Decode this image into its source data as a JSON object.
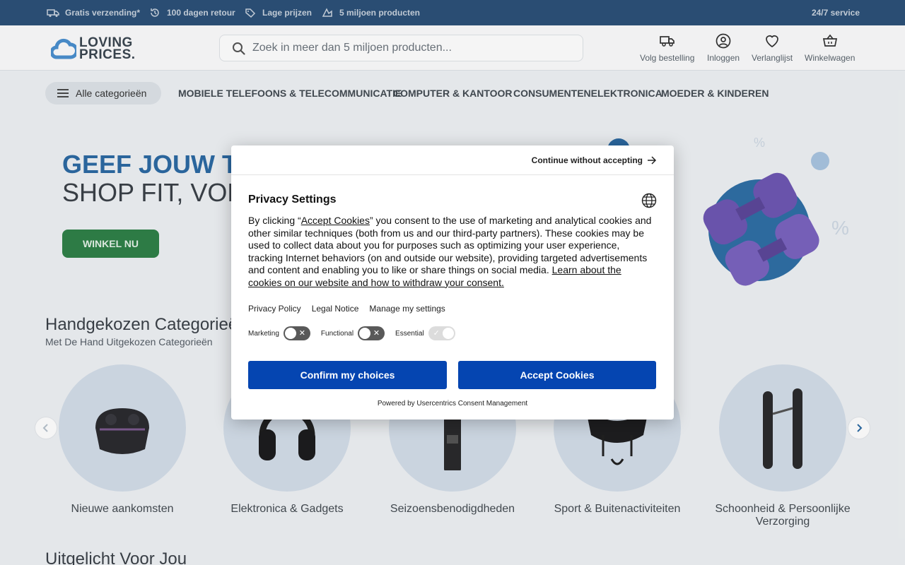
{
  "topbar": {
    "usps": [
      {
        "icon": "truck-icon",
        "label": "Gratis verzending*"
      },
      {
        "icon": "return-icon",
        "label": "100 dagen retour"
      },
      {
        "icon": "tag-icon",
        "label": "Lage prijzen"
      },
      {
        "icon": "products-icon",
        "label": "5 miljoen producten"
      }
    ],
    "service": "24/7 service"
  },
  "header": {
    "logo_line1": "LOVING",
    "logo_line2": "PRICES.",
    "search_placeholder": "Zoek in meer dan 5 miljoen producten...",
    "buttons": {
      "track": "Volg bestelling",
      "login": "Inloggen",
      "wishlist": "Verlanglijst",
      "cart": "Winkelwagen"
    }
  },
  "nav": {
    "all_categories": "Alle categorieën",
    "links": [
      "MOBIELE TELEFOONS & TELECOMMUNICATIE",
      "COMPUTER & KANTOOR",
      "CONSUMENTENELEKTRONICA",
      "MOEDER & KINDEREN"
    ]
  },
  "hero": {
    "title": "GEEF JOUW TR",
    "subtitle": "SHOP FIT, VOEL",
    "button": "WINKEL NU"
  },
  "categories": {
    "title": "Handgekozen Categorieë",
    "subtitle": "Met De Hand Uitgekozen Categorieën",
    "items": [
      {
        "label": "Nieuwe aankomsten",
        "icon": "earbuds-icon"
      },
      {
        "label": "Elektronica & Gadgets",
        "icon": "headphones-icon"
      },
      {
        "label": "Seizoensbenodigdheden",
        "icon": "bottle-icon"
      },
      {
        "label": "Sport & Buitenactiviteiten",
        "icon": "helmet-icon"
      },
      {
        "label": "Schoonheid & Persoonlijke Verzorging",
        "icon": "hair-tool-icon"
      }
    ]
  },
  "featured_title": "Uitgelicht Voor Jou",
  "consent": {
    "continue": "Continue without accepting",
    "title": "Privacy Settings",
    "text_before": "By clicking “",
    "text_link": "Accept Cookies",
    "text_middle": "” you consent to the use of marketing and analytical cookies and other similar techniques (both from us and our third-party partners). These cookies may be used to collect data about you for purposes such as optimizing your user experience, tracking Internet behaviors (on and outside our website), providing targeted advertisements and content and enabling you to like or share things on social media. ",
    "text_learn": "Learn about the cookies on our website and how to withdraw your consent.",
    "links": [
      "Privacy Policy",
      "Legal Notice",
      "Manage my settings"
    ],
    "toggles": [
      {
        "label": "Marketing",
        "state": "off"
      },
      {
        "label": "Functional",
        "state": "off"
      },
      {
        "label": "Essential",
        "state": "on"
      }
    ],
    "confirm": "Confirm my choices",
    "accept": "Accept Cookies",
    "powered": "Powered by Usercentrics Consent Management",
    "accent": "#0545b1"
  },
  "colors": {
    "topbar": "#2c5178",
    "hero_title": "#2c6aa3",
    "hero_button": "#2f8048",
    "category_circle": "#d3dde9"
  }
}
